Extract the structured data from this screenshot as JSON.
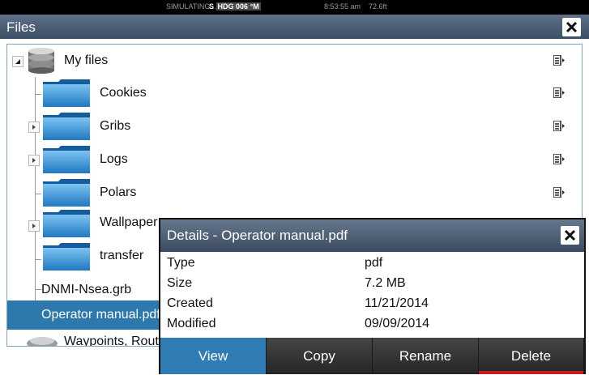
{
  "status": {
    "simulating": "SIMULATING...",
    "hdg_prefix": "S",
    "hdg_label": "HDG",
    "hdg_value": "006",
    "hdg_unit": "°M",
    "time": "8:53:55 am",
    "depth": "72.6ft"
  },
  "window": {
    "title": "Files"
  },
  "tree": {
    "items": [
      {
        "label": "My files"
      },
      {
        "label": "Cookies"
      },
      {
        "label": "Gribs"
      },
      {
        "label": "Logs"
      },
      {
        "label": "Polars"
      },
      {
        "label": "Wallpaper"
      },
      {
        "label": "transfer"
      },
      {
        "label": "DNMI-Nsea.grb"
      },
      {
        "label": "Operator manual.pdf"
      },
      {
        "label": "Waypoints, Routes..."
      }
    ]
  },
  "details": {
    "title": "Details - Operator manual.pdf",
    "rows": [
      {
        "key": "Type",
        "value": "pdf"
      },
      {
        "key": "Size",
        "value": "7.2 MB"
      },
      {
        "key": "Created",
        "value": "11/21/2014"
      },
      {
        "key": "Modified",
        "value": "09/09/2014"
      }
    ],
    "buttons": [
      {
        "label": "View"
      },
      {
        "label": "Copy"
      },
      {
        "label": "Rename"
      },
      {
        "label": "Delete"
      }
    ]
  },
  "colors": {
    "accent": "#2f7db4",
    "selection": "#2d79ad",
    "delete_marker": "#c81b1b",
    "titlebar": "#4a5c73"
  }
}
